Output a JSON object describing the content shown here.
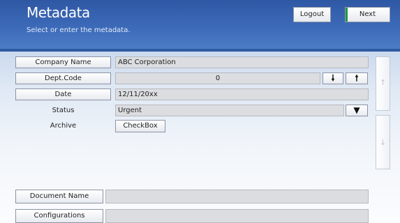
{
  "header": {
    "title": "Metadata",
    "subtitle": "Select or enter the metadata.",
    "logout_label": "Logout",
    "next_label": "Next"
  },
  "form": {
    "company": {
      "label": "Company Name",
      "value": "ABC Corporation"
    },
    "dept": {
      "label": "Dept.Code",
      "value": "0",
      "down_icon": "arrow-down-icon",
      "up_icon": "arrow-up-icon",
      "down_glyph": "🠗",
      "up_glyph": "🠕"
    },
    "date": {
      "label": "Date",
      "value": "12/11/20xx"
    },
    "status": {
      "label": "Status",
      "value": "Urgent",
      "dropdown_glyph": "▼"
    },
    "archive": {
      "label": "Archive",
      "button_label": "CheckBox"
    },
    "document_name": {
      "label": "Document Name",
      "value": ""
    },
    "configurations": {
      "label": "Configurations",
      "value": ""
    }
  },
  "scroll": {
    "up_glyph": "↑",
    "down_glyph": "↓"
  },
  "colors": {
    "header_blue": "#3c6ab8",
    "next_accent": "#1f9a3e",
    "field_gray": "#dcdde0"
  }
}
